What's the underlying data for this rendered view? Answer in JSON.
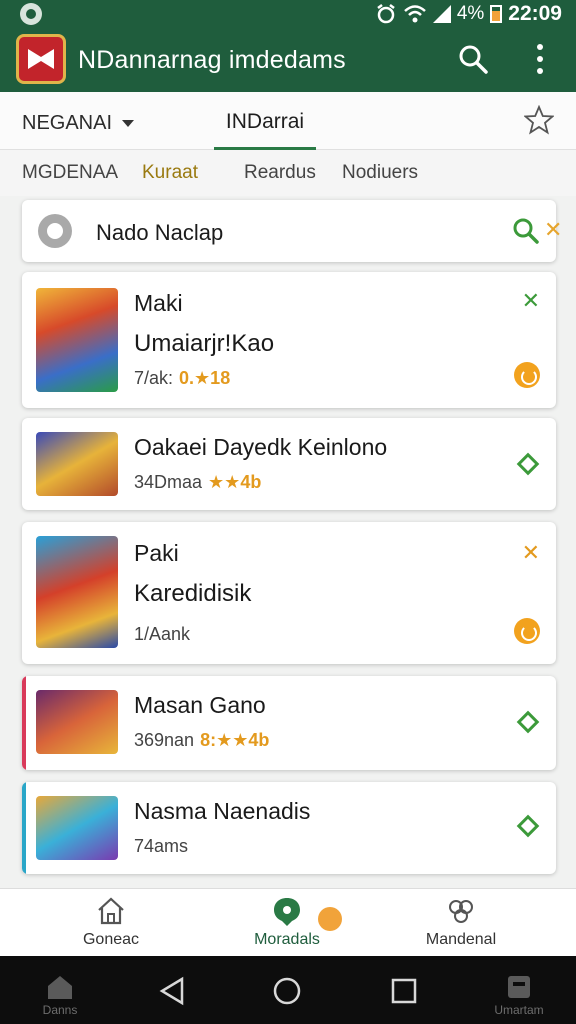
{
  "status": {
    "battery": "4%",
    "time": "22:09"
  },
  "appbar": {
    "title": "NDannarnag imdedams"
  },
  "tabs": {
    "dropdown_label": "NEGANAI",
    "active_tab": "INDarrai"
  },
  "filters": [
    "MGDENAA",
    "Kuraat",
    "Reardus",
    "Nodiuers"
  ],
  "search": {
    "query": "Nado Naclap"
  },
  "cards": [
    {
      "line1": "Maki",
      "line2": "Umaiarjr!Kao",
      "meta": "7/ak:",
      "rating": "0.★18"
    },
    {
      "line1": "Oakaei Dayedk Keinlono",
      "meta": "34Dmaa",
      "rating": "★★4b"
    },
    {
      "line1": "Paki",
      "line2": "Karedidisik",
      "meta": "1/Aank"
    },
    {
      "line1": "Masan Gano",
      "meta": "369nan",
      "rating": "8:★★4b"
    },
    {
      "line1": "Nasma Naenadis",
      "meta": "74ams"
    }
  ],
  "bottom_nav": [
    {
      "label": "Goneac",
      "icon": "home-icon"
    },
    {
      "label": "Moradals",
      "icon": "chat-icon"
    },
    {
      "label": "Mandenal",
      "icon": "settings-icon"
    }
  ],
  "system_nav": {
    "left_label": "Danns",
    "right_label": "Umartam"
  },
  "colors": {
    "primary": "#1f5d3d",
    "accent": "#f2a21e",
    "green": "#3c9a3a"
  }
}
